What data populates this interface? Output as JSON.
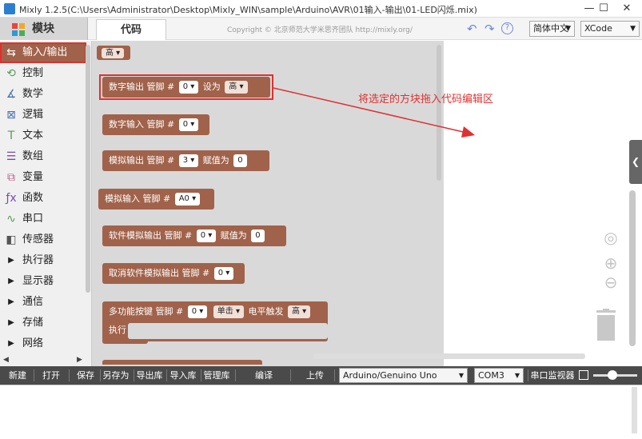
{
  "window": {
    "title": "Mixly 1.2.5(C:\\Users\\Administrator\\Desktop\\Mixly_WIN\\sample\\Arduino\\AVR\\01输入-输出\\01-LED闪烁.mix)"
  },
  "header": {
    "module_tab": "模块",
    "code_tab": "代码",
    "copyright": "Copyright © 北京师范大学米思齐团队 http://mixly.org/",
    "language": "简体中文",
    "theme": "XCode"
  },
  "sidebar": {
    "items": [
      {
        "label": "输入/输出",
        "icon": "io-icon"
      },
      {
        "label": "控制",
        "icon": "control-icon"
      },
      {
        "label": "数学",
        "icon": "math-icon"
      },
      {
        "label": "逻辑",
        "icon": "logic-icon"
      },
      {
        "label": "文本",
        "icon": "text-icon"
      },
      {
        "label": "数组",
        "icon": "array-icon"
      },
      {
        "label": "变量",
        "icon": "variable-icon"
      },
      {
        "label": "函数",
        "icon": "function-icon"
      },
      {
        "label": "串口",
        "icon": "serial-icon"
      },
      {
        "label": "传感器",
        "icon": "sensor-icon"
      },
      {
        "label": "执行器",
        "icon": "triangle-icon"
      },
      {
        "label": "显示器",
        "icon": "triangle-icon"
      },
      {
        "label": "通信",
        "icon": "triangle-icon"
      },
      {
        "label": "存储",
        "icon": "triangle-icon"
      },
      {
        "label": "网络",
        "icon": "triangle-icon"
      }
    ]
  },
  "blocks": {
    "high": "高",
    "dw": {
      "label": "数字输出 管脚 #",
      "pin": "0",
      "set": "设为",
      "val": "高"
    },
    "dr": {
      "label": "数字输入 管脚 #",
      "pin": "0"
    },
    "aw": {
      "label": "模拟输出 管脚 #",
      "pin": "3",
      "assign": "赋值为",
      "val": "0"
    },
    "ar": {
      "label": "模拟输入 管脚 #",
      "pin": "A0"
    },
    "sw": {
      "label": "软件模拟输出 管脚 #",
      "pin": "0",
      "assign": "赋值为",
      "val": "0"
    },
    "cancel": {
      "label": "取消软件模拟输出 管脚 #",
      "pin": "0"
    },
    "btn": {
      "label": "多功能按键 管脚 #",
      "pin": "0",
      "mode": "单击",
      "trig": "电平触发",
      "val": "高",
      "exec": "执行"
    }
  },
  "annotation": "将选定的方块拖入代码编辑区",
  "toolbar": {
    "new": "新建",
    "open": "打开",
    "save": "保存",
    "save_as": "另存为",
    "export_lib": "导出库",
    "import_lib": "导入库",
    "manage_lib": "管理库",
    "compile": "编译",
    "upload": "上传",
    "board": "Arduino/Genuino Uno",
    "port": "COM3",
    "monitor": "串口监视器"
  },
  "colors": {
    "block": "#a0624a",
    "highlight": "#e03030",
    "toolbar": "#4a4a4a"
  }
}
